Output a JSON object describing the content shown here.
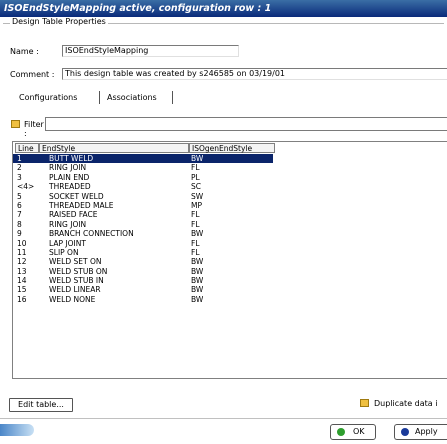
{
  "window": {
    "title": "ISOEndStyleMapping active, configuration row : 1"
  },
  "properties": {
    "group_title": "Design Table Properties",
    "name_label": "Name :",
    "name_value": "ISOEndStyleMapping",
    "comment_label": "Comment :",
    "comment_value": "This design table was created by s246585 on 03/19/01"
  },
  "tabs": [
    "Configurations",
    "Associations"
  ],
  "filter": {
    "label": "Filter :",
    "value": ""
  },
  "table": {
    "columns": [
      "Line",
      "EndStyle",
      "ISOgenEndStyle"
    ],
    "rows": [
      [
        "1",
        "BUTT WELD",
        "BW"
      ],
      [
        "2",
        "RING JOIN",
        "FL"
      ],
      [
        "3",
        "PLAIN END",
        "PL"
      ],
      [
        "<4>",
        "THREADED",
        "SC"
      ],
      [
        "5",
        "SOCKET WELD",
        "SW"
      ],
      [
        "6",
        "THREADED MALE",
        "MP"
      ],
      [
        "7",
        "RAISED FACE",
        "FL"
      ],
      [
        "8",
        "RING JOIN",
        "FL"
      ],
      [
        "9",
        "BRANCH CONNECTION",
        "BW"
      ],
      [
        "10",
        "LAP JOINT",
        "FL"
      ],
      [
        "11",
        "SLIP ON",
        "FL"
      ],
      [
        "12",
        "WELD SET ON",
        "BW"
      ],
      [
        "13",
        "WELD STUB ON",
        "BW"
      ],
      [
        "14",
        "WELD STUB IN",
        "BW"
      ],
      [
        "15",
        "WELD LINEAR",
        "BW"
      ],
      [
        "16",
        "WELD NONE",
        "BW"
      ]
    ],
    "selected_row": 0
  },
  "buttons": {
    "edit_table": "Edit table...",
    "duplicate_label": "Duplicate data i",
    "ok": "OK",
    "apply": "Apply"
  },
  "colors": {
    "title_bar": "#0a2a7a",
    "selection": "#0a246a",
    "ok_icon": "#2e9e2e",
    "apply_icon": "#1a3a9a"
  }
}
